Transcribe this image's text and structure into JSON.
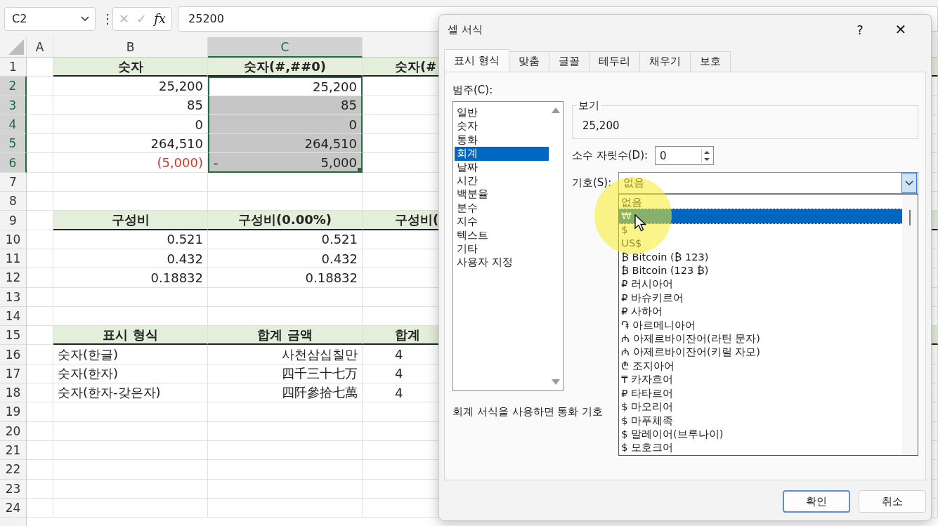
{
  "formula_bar": {
    "name_box": "C2",
    "more": "⋮",
    "cancel": "✕",
    "enter": "✓",
    "function": "fx",
    "formula": "25200"
  },
  "sheet": {
    "columns": [
      {
        "label": "A",
        "selected": false
      },
      {
        "label": "B",
        "selected": false
      },
      {
        "label": "C",
        "selected": true
      }
    ],
    "rows": [
      {
        "n": "1",
        "selected": false,
        "kind": "header",
        "cells": [
          {
            "kind": "plain",
            "text": "숫자"
          },
          {
            "kind": "plain",
            "text": "숫자(#,##0)"
          },
          {
            "kind": "plain",
            "text": "숫자(#"
          }
        ]
      },
      {
        "n": "2",
        "selected": true,
        "kind": "number",
        "cells": [
          {
            "kind": "plain",
            "text": "25,200"
          },
          {
            "kind": "plain",
            "text": "25,200"
          }
        ]
      },
      {
        "n": "3",
        "selected": true,
        "kind": "number",
        "cells": [
          {
            "kind": "plain",
            "text": "85"
          },
          {
            "kind": "plain",
            "text": "85"
          }
        ]
      },
      {
        "n": "4",
        "selected": true,
        "kind": "number",
        "cells": [
          {
            "kind": "plain",
            "text": "0"
          },
          {
            "kind": "plain",
            "text": "0"
          }
        ]
      },
      {
        "n": "5",
        "selected": true,
        "kind": "number",
        "cells": [
          {
            "kind": "plain",
            "text": "264,510"
          },
          {
            "kind": "plain",
            "text": "264,510"
          }
        ]
      },
      {
        "n": "6",
        "selected": true,
        "kind": "number",
        "cells": [
          {
            "kind": "negative",
            "text": "(5,000)"
          },
          {
            "kind": "accounting",
            "sign": "-",
            "text": "5,000"
          }
        ]
      },
      {
        "n": "7",
        "selected": false,
        "kind": "number",
        "cells": []
      },
      {
        "n": "8",
        "selected": false,
        "kind": "number",
        "cells": []
      },
      {
        "n": "9",
        "selected": false,
        "kind": "header",
        "cells": [
          {
            "kind": "plain",
            "text": "구성비"
          },
          {
            "kind": "plain",
            "text": "구성비(0.00%)"
          },
          {
            "kind": "plain",
            "text": "구성비("
          }
        ]
      },
      {
        "n": "10",
        "selected": false,
        "kind": "number",
        "cells": [
          {
            "kind": "plain",
            "text": "0.521"
          },
          {
            "kind": "plain",
            "text": "0.521"
          }
        ]
      },
      {
        "n": "11",
        "selected": false,
        "kind": "number",
        "cells": [
          {
            "kind": "plain",
            "text": "0.432"
          },
          {
            "kind": "plain",
            "text": "0.432"
          }
        ]
      },
      {
        "n": "12",
        "selected": false,
        "kind": "number",
        "cells": [
          {
            "kind": "plain",
            "text": "0.18832"
          },
          {
            "kind": "plain",
            "text": "0.18832"
          }
        ]
      },
      {
        "n": "13",
        "selected": false,
        "kind": "number",
        "cells": []
      },
      {
        "n": "14",
        "selected": false,
        "kind": "number",
        "cells": []
      },
      {
        "n": "15",
        "selected": false,
        "kind": "header",
        "cells": [
          {
            "kind": "plain",
            "text": "표시 형식"
          },
          {
            "kind": "plain",
            "text": "합계 금액"
          },
          {
            "kind": "plain",
            "text": "합계"
          }
        ]
      },
      {
        "n": "16",
        "selected": false,
        "kind": "label",
        "cells": [
          {
            "kind": "plain",
            "text": "숫자(한글)"
          },
          {
            "kind": "plain",
            "text": "사천삼십칠만"
          },
          {
            "kind": "plain",
            "text": "4"
          }
        ]
      },
      {
        "n": "17",
        "selected": false,
        "kind": "label",
        "cells": [
          {
            "kind": "plain",
            "text": "숫자(한자)"
          },
          {
            "kind": "plain",
            "text": "四千三十七万"
          },
          {
            "kind": "plain",
            "text": "4"
          }
        ]
      },
      {
        "n": "18",
        "selected": false,
        "kind": "label",
        "cells": [
          {
            "kind": "plain",
            "text": "숫자(한자-갖은자)"
          },
          {
            "kind": "plain",
            "text": "四阡參拾七萬"
          },
          {
            "kind": "plain",
            "text": "4"
          }
        ]
      },
      {
        "n": "19",
        "selected": false,
        "kind": "number",
        "cells": []
      },
      {
        "n": "20",
        "selected": false,
        "kind": "number",
        "cells": []
      },
      {
        "n": "21",
        "selected": false,
        "kind": "number",
        "cells": []
      },
      {
        "n": "22",
        "selected": false,
        "kind": "number",
        "cells": []
      },
      {
        "n": "23",
        "selected": false,
        "kind": "number",
        "cells": []
      },
      {
        "n": "24",
        "selected": false,
        "kind": "number",
        "cells": []
      }
    ]
  },
  "dialog": {
    "title": "셀 서식",
    "help": "?",
    "close": "✕",
    "tabs": [
      {
        "label": "표시 형식",
        "selected": true
      },
      {
        "label": "맞춤",
        "selected": false
      },
      {
        "label": "글꼴",
        "selected": false
      },
      {
        "label": "테두리",
        "selected": false
      },
      {
        "label": "채우기",
        "selected": false
      },
      {
        "label": "보호",
        "selected": false
      }
    ],
    "category_label": "범주(C):",
    "categories": [
      {
        "label": "일반",
        "selected": false
      },
      {
        "label": "숫자",
        "selected": false
      },
      {
        "label": "통화",
        "selected": false
      },
      {
        "label": "회계",
        "selected": true
      },
      {
        "label": "날짜",
        "selected": false
      },
      {
        "label": "시간",
        "selected": false
      },
      {
        "label": "백분율",
        "selected": false
      },
      {
        "label": "분수",
        "selected": false
      },
      {
        "label": "지수",
        "selected": false
      },
      {
        "label": "텍스트",
        "selected": false
      },
      {
        "label": "기타",
        "selected": false
      },
      {
        "label": "사용자 지정",
        "selected": false
      }
    ],
    "preview_label": "보기",
    "preview_value": "25,200",
    "decimals_label": "소수 자릿수(D):",
    "decimals_value": "0",
    "symbol_label": "기호(S):",
    "symbol_value": "없음",
    "symbol_options": [
      {
        "label": "없음",
        "selected": false
      },
      {
        "label": "₩",
        "selected": true
      },
      {
        "label": "$",
        "selected": false
      },
      {
        "label": "US$",
        "selected": false
      },
      {
        "label": "₿ Bitcoin (₿ 123)",
        "selected": false
      },
      {
        "label": "₿ Bitcoin (123 ₿)",
        "selected": false
      },
      {
        "label": "₽ 러시아어",
        "selected": false
      },
      {
        "label": "₽ 바슈키르어",
        "selected": false
      },
      {
        "label": "₽ 사하어",
        "selected": false
      },
      {
        "label": "֏ 아르메니아어",
        "selected": false
      },
      {
        "label": "₼ 아제르바이잔어(라틴 문자)",
        "selected": false
      },
      {
        "label": "₼ 아제르바이잔어(키릴 자모)",
        "selected": false
      },
      {
        "label": "₾ 조지아어",
        "selected": false
      },
      {
        "label": "₸ 카자흐어",
        "selected": false
      },
      {
        "label": "₽ 타타르어",
        "selected": false
      },
      {
        "label": "$ 마오리어",
        "selected": false
      },
      {
        "label": "$ 마푸체족",
        "selected": false
      },
      {
        "label": "$ 말레이어(브루나이)",
        "selected": false
      },
      {
        "label": "$ 모호크어",
        "selected": false
      }
    ],
    "info": "회계 서식을 사용하면 통화 기호",
    "buttons": [
      {
        "label": "확인",
        "kind": "default"
      },
      {
        "label": "취소",
        "kind": "normal"
      }
    ]
  }
}
